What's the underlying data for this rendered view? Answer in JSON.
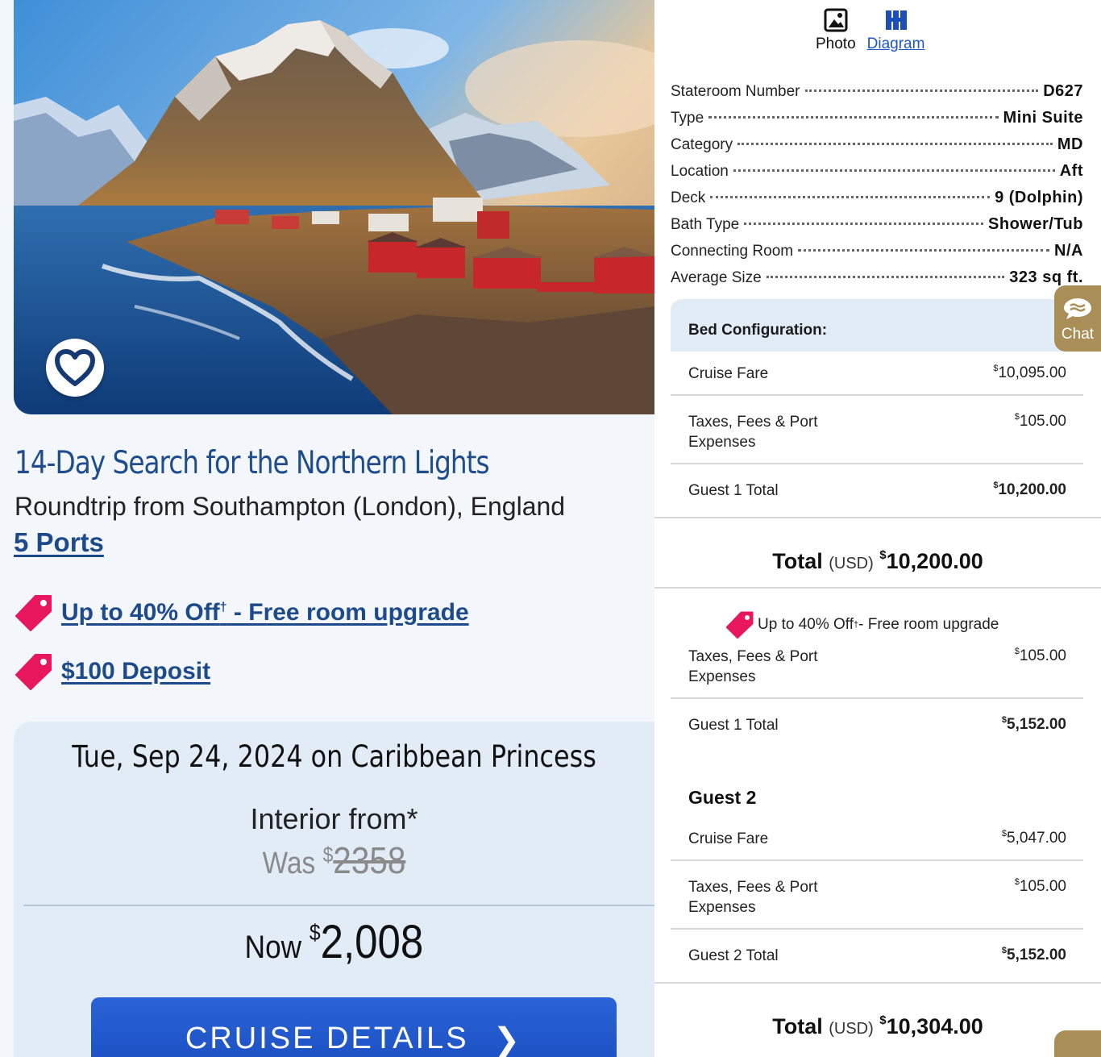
{
  "cruise": {
    "title": "14-Day Search for the Northern Lights",
    "route": "Roundtrip from Southampton (London), England",
    "ports_link": "5 Ports",
    "promos": [
      {
        "text": "Up to 40% Off",
        "dagger": "†",
        "rest": " - Free room upgrade"
      },
      {
        "text": "$100 Deposit"
      }
    ]
  },
  "sailing": {
    "date_ship": "Tue, Sep 24, 2024 on Caribbean Princess",
    "room_from": "Interior from*",
    "was_label": "Was",
    "currency": "$",
    "was_price": "2358",
    "now_label": "Now",
    "now_price": "2,008",
    "details_button": "CRUISE DETAILS",
    "details_chevron": "❯"
  },
  "view_toggle": {
    "photo_label": "Photo",
    "diagram_label": "Diagram"
  },
  "stateroom_specs": [
    {
      "label": "Stateroom Number",
      "value": "D627"
    },
    {
      "label": "Type",
      "value": "Mini Suite"
    },
    {
      "label": "Category",
      "value": "MD"
    },
    {
      "label": "Location",
      "value": "Aft"
    },
    {
      "label": "Deck",
      "value": "9 (Dolphin)"
    },
    {
      "label": "Bath Type",
      "value": "Shower/Tub"
    },
    {
      "label": "Connecting Room",
      "value": "N/A"
    },
    {
      "label": "Average Size",
      "value": "323 sq ft."
    }
  ],
  "bed_config_label": "Bed Configuration:",
  "chat_label": "Chat",
  "pricing": {
    "currency": "$",
    "guest1_block1": {
      "cruise_fare_label": "Cruise Fare",
      "cruise_fare": "10,095.00",
      "taxes_label": "Taxes, Fees & Port Expenses",
      "taxes": "105.00",
      "total_label": "Guest 1 Total",
      "total": "10,200.00"
    },
    "total1": {
      "label": "Total",
      "unit": "(USD)",
      "value": "10,200.00"
    },
    "promo_mini": {
      "text": "Up to 40% Off",
      "dagger": "†",
      "rest": " - Free room upgrade"
    },
    "guest1_block2": {
      "taxes_label": "Taxes, Fees & Port Expenses",
      "taxes": "105.00",
      "total_label": "Guest 1 Total",
      "total": "5,152.00"
    },
    "guest2": {
      "heading": "Guest 2",
      "cruise_fare_label": "Cruise Fare",
      "cruise_fare": "5,047.00",
      "taxes_label": "Taxes, Fees & Port Expenses",
      "taxes": "105.00",
      "total_label": "Guest 2 Total",
      "total": "5,152.00"
    },
    "total2": {
      "label": "Total",
      "unit": "(USD)",
      "value": "10,304.00"
    }
  },
  "colors": {
    "brand_navy": "#1d4a8a",
    "promo_pink": "#e8175d",
    "button_blue": "#1f56c8",
    "chat_gold": "#a98f57",
    "card_blue": "#e1ecf7"
  }
}
